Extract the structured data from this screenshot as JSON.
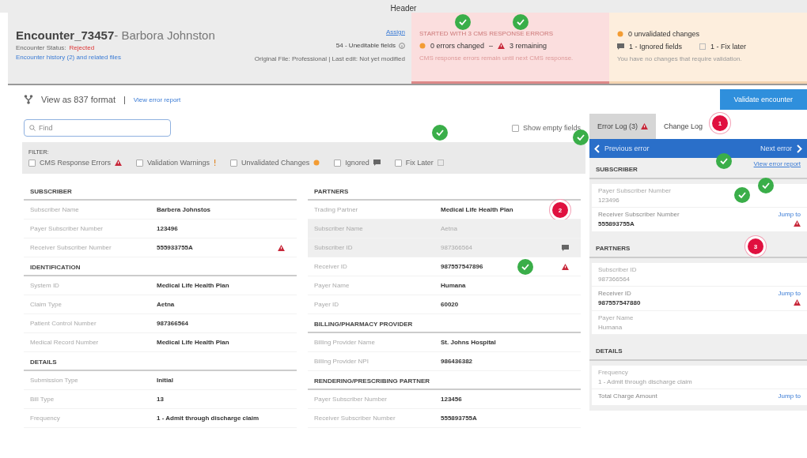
{
  "header_bar": {
    "title": "Header"
  },
  "encounter": {
    "id": "Encounter_73457",
    "name": "- Barbora Johnston",
    "status_label": "Encounter Status:",
    "status": "Rejected",
    "history_link": "Encounter history (2) and related files",
    "assign_link": "Assign",
    "uneditable": "54 - Uneditable fields",
    "file_info": "Original File: Professional | Last edit: Not yet modified"
  },
  "cms_panel": {
    "title": "STARTED WITH 3 CMS RESPONSE ERRORS",
    "changed": "0 errors changed",
    "separator": "–",
    "remaining": "3 remaining",
    "note": "CMS response errors remain until next CMS response.",
    "markers": [
      {
        "kind": "check"
      },
      {
        "kind": "check"
      }
    ]
  },
  "changes_panel": {
    "unvalidated": "0 unvalidated changes",
    "ignored": "1 - Ignored fields",
    "fix_later": "1 - Fix later",
    "note": "You have no changes that require validation."
  },
  "toolbar": {
    "view_format": "View as 837 format",
    "separator": "|",
    "error_report_link": "View error report",
    "validate_button": "Validate encounter"
  },
  "search": {
    "placeholder": "Find"
  },
  "show_empty": {
    "label": "Show empty fields",
    "checked": false,
    "marker": {
      "kind": "check"
    }
  },
  "filter": {
    "title": "FILTER:",
    "marker": {
      "kind": "check"
    },
    "options": [
      {
        "label": "CMS Response Errors",
        "kind": "warning",
        "checked": false
      },
      {
        "label": "Validation Warnings",
        "kind": "exclamation",
        "checked": false
      },
      {
        "label": "Unvalidated Changes",
        "kind": "dot",
        "checked": false
      },
      {
        "label": "Ignored",
        "kind": "comment",
        "checked": false
      },
      {
        "label": "Fix Later",
        "kind": "square",
        "checked": false
      }
    ]
  },
  "form": {
    "columns": [
      [
        {
          "title": "SUBSCRIBER",
          "rows": [
            {
              "label": "Subscriber Name",
              "value": "Barbera Johnstos",
              "ignored": false
            },
            {
              "label": "Payer Subscriber Number",
              "value": "123496",
              "ignored": false
            },
            {
              "label": "Receiver Subscriber Number",
              "value": "555933755A",
              "ignored": false,
              "kind": "warning"
            }
          ]
        },
        {
          "title": "IDENTIFICATION",
          "rows": [
            {
              "label": "System ID",
              "value": "Medical Life Health Plan",
              "ignored": false
            },
            {
              "label": "Claim Type",
              "value": "Aetna",
              "ignored": false
            },
            {
              "label": "Patient Control Number",
              "value": "987366564",
              "ignored": false
            },
            {
              "label": "Medical Record Number",
              "value": "Medical Life Health Plan",
              "ignored": false
            }
          ]
        },
        {
          "title": "DETAILS",
          "rows": [
            {
              "label": "Submission Type",
              "value": "Initial",
              "ignored": false
            },
            {
              "label": "Bill Type",
              "value": "13",
              "ignored": false
            },
            {
              "label": "Frequency",
              "value": "1 - Admit through discharge claim",
              "ignored": false
            }
          ]
        }
      ],
      [
        {
          "title": "PARTNERS",
          "rows": [
            {
              "label": "Trading Partner",
              "value": "Medical Life Health Plan",
              "ignored": false,
              "marker": {
                "kind": "number",
                "text": "2"
              }
            },
            {
              "label": "Subscriber Name",
              "value": "Aetna",
              "ignored": true
            },
            {
              "label": "Subscriber ID",
              "value": "987366564",
              "ignored": true,
              "kind": "comment"
            },
            {
              "label": "Receiver ID",
              "value": "987557547896",
              "ignored": false,
              "kind": "warning",
              "marker": {
                "kind": "check"
              }
            },
            {
              "label": "Payer Name",
              "value": "Humana",
              "ignored": false
            },
            {
              "label": "Payer ID",
              "value": "60020",
              "ignored": false
            }
          ]
        },
        {
          "title": "BILLING/PHARMACY PROVIDER",
          "rows": [
            {
              "label": "Billing Provider Name",
              "value": "St. Johns Hospital",
              "ignored": false
            },
            {
              "label": "Billing Provider NPI",
              "value": "986436382",
              "ignored": false
            }
          ]
        },
        {
          "title": "RENDERING/PRESCRIBING PARTNER",
          "rows": [
            {
              "label": "Payer Subscriber Number",
              "value": "123456",
              "ignored": false
            },
            {
              "label": "Receiver Subscriber Number",
              "value": "555893755A",
              "ignored": false
            }
          ]
        }
      ]
    ]
  },
  "error_log": {
    "tabs": [
      {
        "label": "Error Log (3)",
        "selected": true,
        "kind": "warning"
      },
      {
        "label": "Change Log",
        "selected": false,
        "kind": "plain",
        "marker": {
          "kind": "number",
          "text": "1"
        }
      }
    ],
    "previous": "Previous error",
    "next": "Next error",
    "report_link": "View error report",
    "report_marker": {
      "kind": "check"
    },
    "sections": [
      {
        "title": "SUBSCRIBER",
        "fields": [
          {
            "label": "Payer Subscriber Number",
            "value": "123496",
            "resolved": true,
            "marker": {
              "kind": "check"
            }
          },
          {
            "label": "Receiver Subscriber Number",
            "value": "555893755A",
            "resolved": false,
            "jump": "Jump to"
          }
        ]
      },
      {
        "title": "PARTNERS",
        "marker": {
          "kind": "number",
          "text": "3"
        },
        "fields": [
          {
            "label": "Subscriber ID",
            "value": "987366564",
            "resolved": true
          },
          {
            "label": "Receiver ID",
            "value": "987557547880",
            "resolved": false,
            "jump": "Jump to"
          },
          {
            "label": "Payer Name",
            "value": "Humana",
            "resolved": true
          }
        ]
      },
      {
        "title": "DETAILS",
        "fields": [
          {
            "label": "Frequency",
            "value": "1 - Admit through discharge claim",
            "resolved": true
          },
          {
            "label": "Total Charge Amount",
            "resolved": false,
            "jump": "Jump to"
          }
        ]
      }
    ]
  }
}
